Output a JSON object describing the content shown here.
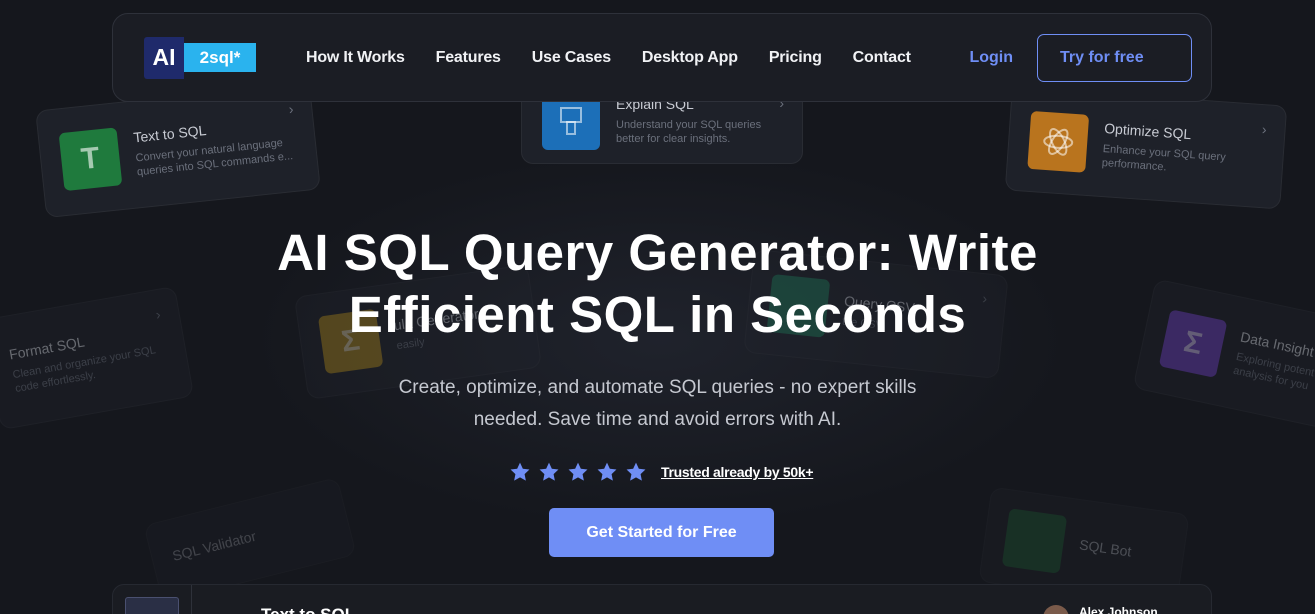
{
  "nav": {
    "logo_ai": "AI",
    "logo_sql": "2sql*",
    "links": [
      "How It Works",
      "Features",
      "Use Cases",
      "Desktop App",
      "Pricing",
      "Contact"
    ],
    "login": "Login",
    "try_free": "Try for free"
  },
  "bg_cards": {
    "text_to_sql": {
      "title": "Text to SQL",
      "desc": "Convert your natural language queries into SQL commands e...",
      "icon": "T"
    },
    "explain_sql": {
      "title": "Explain SQL",
      "desc": "Understand your SQL queries better for clear insights."
    },
    "optimize_sql": {
      "title": "Optimize SQL",
      "desc": "Enhance your SQL query performance."
    },
    "format_sql": {
      "title": "Format SQL",
      "desc": "Clean and organize your SQL code effortlessly."
    },
    "formula_generator": {
      "title": "ula Generator",
      "desc": "easily",
      "icon": "Σ"
    },
    "query_csv": {
      "title": "Query CSV",
      "desc": "the CSV"
    },
    "data_insights": {
      "title": "Data Insight",
      "desc": "Exploring potent analysis for you",
      "icon": "Σ"
    },
    "sql_validator": {
      "title": "SQL Validator"
    },
    "sql_bot": {
      "title": "SQL Bot"
    }
  },
  "hero": {
    "title_line1": "AI SQL Query Generator: Write",
    "title_line2": "Efficient SQL in Seconds",
    "sub_line1": "Create, optimize, and automate SQL queries - no expert skills",
    "sub_line2": "needed. Save time and avoid errors with AI.",
    "rating_stars": 5,
    "trusted": "Trusted already by 50k+",
    "cta": "Get Started for Free"
  },
  "preview": {
    "back_arrow": "←",
    "title": "Text to SQL",
    "user": "Alex Johnson"
  },
  "colors": {
    "accent": "#6f8ef5",
    "background": "#15171d",
    "star": "#6f8ef5"
  }
}
